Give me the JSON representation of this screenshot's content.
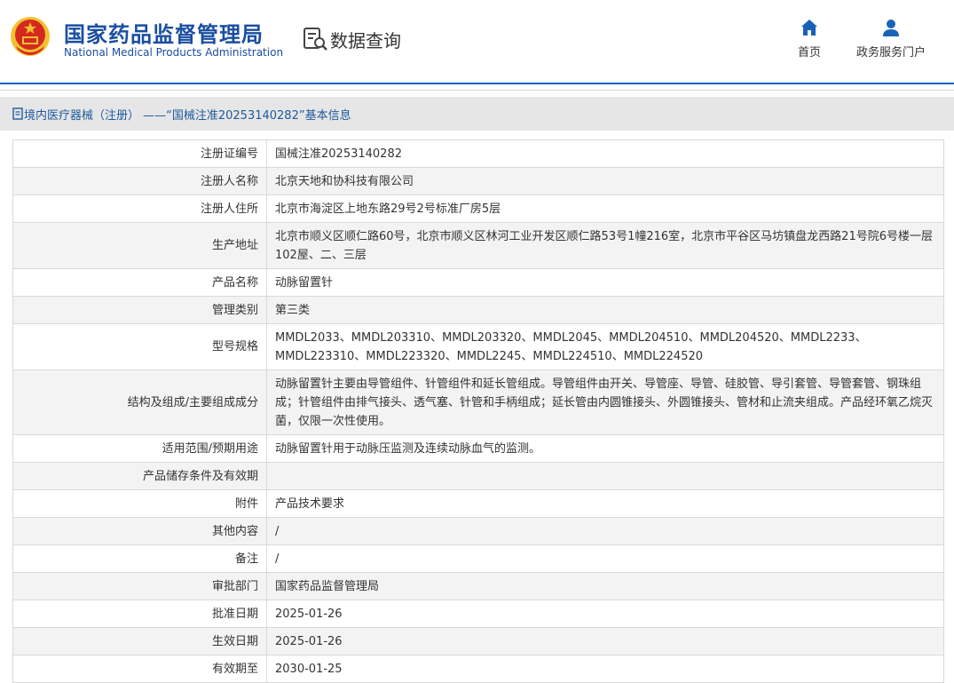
{
  "header": {
    "title_cn": "国家药品监督管理局",
    "title_en": "National Medical Products Administration",
    "search_title": "数据查询",
    "nav": [
      {
        "label": "首页",
        "icon": "home-icon"
      },
      {
        "label": "政务服务门户",
        "icon": "user-icon"
      }
    ]
  },
  "breadcrumb": "境内医疗器械（注册） ——“国械注准20253140282”基本信息",
  "rows": [
    {
      "label": "注册证编号",
      "value": "国械注准20253140282"
    },
    {
      "label": "注册人名称",
      "value": "北京天地和协科技有限公司"
    },
    {
      "label": "注册人住所",
      "value": "北京市海淀区上地东路29号2号标准厂房5层"
    },
    {
      "label": "生产地址",
      "value": "北京市顺义区顺仁路60号，北京市顺义区林河工业开发区顺仁路53号1幢216室，北京市平谷区马坊镇盘龙西路21号院6号楼一层102屋、二、三层"
    },
    {
      "label": "产品名称",
      "value": "动脉留置针"
    },
    {
      "label": "管理类别",
      "value": "第三类"
    },
    {
      "label": "型号规格",
      "value": "MMDL2033、MMDL203310、MMDL203320、MMDL2045、MMDL204510、MMDL204520、MMDL2233、MMDL223310、MMDL223320、MMDL2245、MMDL224510、MMDL224520"
    },
    {
      "label": "结构及组成/主要组成成分",
      "value": "动脉留置针主要由导管组件、针管组件和延长管组成。导管组件由开关、导管座、导管、硅胶管、导引套管、导管套管、钢珠组成；针管组件由排气接头、透气塞、针管和手柄组成；延长管由内圆锥接头、外圆锥接头、管材和止流夹组成。产品经环氧乙烷灭菌，仅限一次性使用。"
    },
    {
      "label": "适用范围/预期用途",
      "value": "动脉留置针用于动脉压监测及连续动脉血气的监测。"
    },
    {
      "label": "产品储存条件及有效期",
      "value": ""
    },
    {
      "label": "附件",
      "value": "产品技术要求"
    },
    {
      "label": "其他内容",
      "value": "/"
    },
    {
      "label": "备注",
      "value": "/"
    },
    {
      "label": "审批部门",
      "value": "国家药品监督管理局"
    },
    {
      "label": "批准日期",
      "value": "2025-01-26"
    },
    {
      "label": "生效日期",
      "value": "2025-01-26"
    },
    {
      "label": "有效期至",
      "value": "2030-01-25"
    }
  ],
  "colors": {
    "brand_blue": "#1a4ea1",
    "accent_blue": "#1a62b8",
    "emblem_red": "#d7281f",
    "emblem_gold": "#f2c230"
  }
}
